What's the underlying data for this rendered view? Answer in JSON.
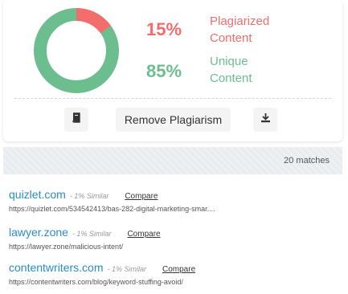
{
  "summary": {
    "plagiarized_pct": "15%",
    "plagiarized_label": "Plagiarized\nContent",
    "unique_pct": "85%",
    "unique_label": "Unique\nContent",
    "plagiarized_fraction": 0.15,
    "colors": {
      "plagiarized": "#f46d6d",
      "unique": "#6dbe8f"
    }
  },
  "actions": {
    "book_icon": "book-icon",
    "remove_label": "Remove Plagiarism",
    "download_icon": "download-icon"
  },
  "matches": {
    "count_label": "20 matches"
  },
  "results": [
    {
      "domain": "quizlet.com",
      "similarity": "- 1% Similar",
      "compare": "Compare",
      "url": "https://quizlet.com/534542413/bas-282-digital-marketing-smar...."
    },
    {
      "domain": "lawyer.zone",
      "similarity": "- 1% Similar",
      "compare": "Compare",
      "url": "https://lawyer.zone/malicious-intent/"
    },
    {
      "domain": "contentwriters.com",
      "similarity": "- 1% Similar",
      "compare": "Compare",
      "url": "https://contentwriters.com/blog/keyword-stuffing-avoid/"
    }
  ]
}
